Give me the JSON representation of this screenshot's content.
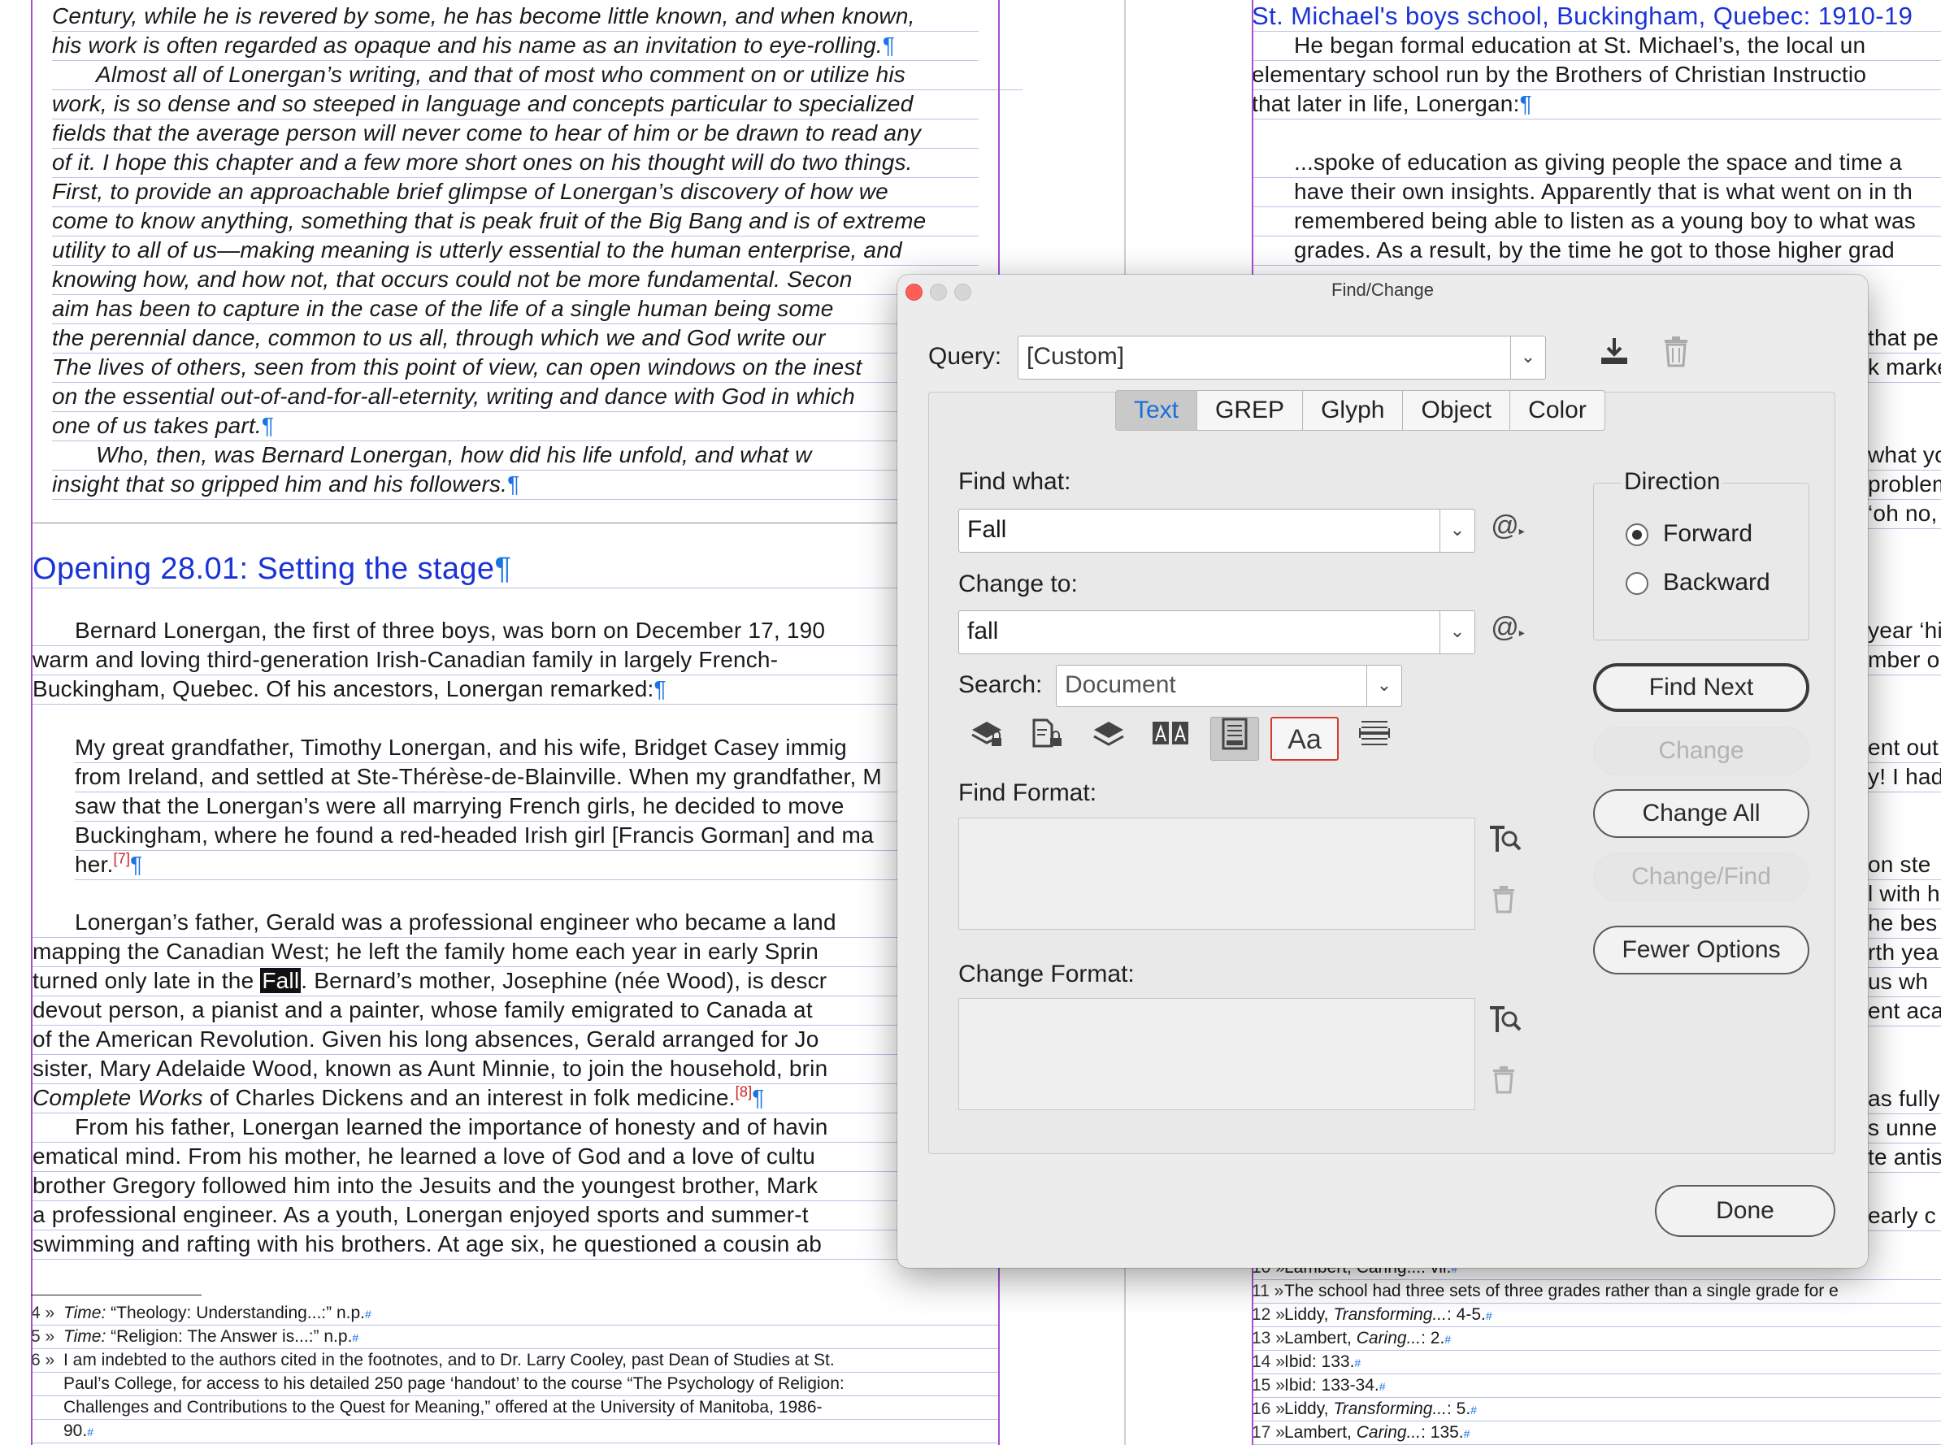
{
  "document": {
    "left_lines": [
      {
        "text": "Century, while he is revered by some, he has become little known, and when known,",
        "italic": true
      },
      {
        "text": "his work is often regarded as opaque and his name as an invitation to eye-rolling.",
        "italic": true,
        "pilcrow": "¶"
      },
      {
        "text": "Almost all of Lonergan’s writing, and that of most who comment on or utilize his",
        "italic": true
      },
      {
        "text": "work, is so dense and so steeped in language and concepts particular to specialized",
        "italic": true
      },
      {
        "text": "fields that the average person will never come to hear of him or be drawn to read any",
        "italic": true
      },
      {
        "text": "of it. I hope this chapter and a few more short ones on his thought will do two things.",
        "italic": true
      },
      {
        "text": "First, to provide an approachable brief glimpse of Lonergan’s discovery of how we",
        "italic": true
      },
      {
        "text": "come to know anything, something that is peak fruit of the Big Bang and is of extreme",
        "italic": true
      },
      {
        "text": "utility to all of us—making meaning is utterly essential to the human enterprise, and",
        "italic": true
      },
      {
        "text": "knowing how, and how not, that occurs could not be more fundamental. Secon",
        "italic": true
      },
      {
        "text": "aim has been to capture in the case of the life of a single human being some",
        "italic": true
      },
      {
        "text": "the perennial dance, common to us all, through which we and God write our",
        "italic": true
      },
      {
        "text": "The lives of others, seen from this point of view, can open windows on the inest",
        "italic": true
      },
      {
        "text": "on the essential out-of-and-for-all-eternity, writing and dance with God in which",
        "italic": true
      },
      {
        "text": "one of us takes part.",
        "italic": true,
        "pilcrow": "¶"
      },
      {
        "text": "Who, then, was Bernard Lonergan, how did his life unfold, and what w",
        "italic": true
      },
      {
        "text": "insight that so gripped him and his followers.",
        "italic": true,
        "pilcrow": "¶"
      }
    ],
    "left_heading": {
      "text": "Opening 28.01: Setting the stage",
      "pilcrow": "¶"
    },
    "left_body_1": [
      {
        "text": "Bernard Lonergan, the first of three boys, was born on December 17, 190"
      },
      {
        "text": "warm and loving third-generation Irish-Canadian family in largely French-"
      },
      {
        "text": "Buckingham, Quebec. Of his ancestors, Lonergan remarked:",
        "pilcrow": "¶"
      }
    ],
    "left_quote": [
      {
        "text": "My great grandfather, Timothy Lonergan, and his wife, Bridget Casey immig"
      },
      {
        "text": "from Ireland, and settled at Ste-Thérèse-de-Blainville. When my grandfather, M"
      },
      {
        "text": "saw that the Lonergan’s were all marrying French girls, he decided to move"
      },
      {
        "text": "Buckingham, where he found a red-headed Irish girl [Francis Gorman] and ma"
      },
      {
        "text": "her.",
        "fnref": "[7]",
        "pilcrow": "¶"
      }
    ],
    "left_body_2": [
      {
        "text": "Lonergan’s father, Gerald was a professional engineer who became a land"
      },
      {
        "text": "mapping the Canadian West; he left the family home each year in early Sprin"
      },
      {
        "before": "turned only late in the ",
        "highlight": "Fall",
        "after": ". Bernard’s mother, Josephine (née Wood), is descr"
      },
      {
        "text": "devout person, a pianist and a painter, whose family emigrated to Canada at"
      },
      {
        "text": "of the American Revolution. Given his long absences, Gerald arranged for Jo"
      },
      {
        "text": "sister, Mary Adelaide Wood, known as Aunt Minnie, to join the household, brin"
      },
      {
        "italic_part": "Complete Works",
        "text": " of Charles Dickens and an interest in folk medicine.",
        "fnref": "[8]",
        "pilcrow": "¶"
      },
      {
        "text": "From his father, Lonergan learned the importance of honesty and of havin"
      },
      {
        "text": "ematical mind. From his mother, he learned a love of God and a love of cultu"
      },
      {
        "text": "brother Gregory followed him into the Jesuits and the youngest brother, Mark"
      },
      {
        "text": "a professional engineer. As a youth, Lonergan enjoyed sports and summer-t"
      },
      {
        "text": "swimming and rafting with his brothers. At age six, he questioned a cousin ab"
      }
    ],
    "left_footnotes": [
      {
        "num": "4",
        "arrow": "»",
        "italic_part": "Time:",
        "text": " “Theology: Understanding...:” n.p.",
        "mark": "#"
      },
      {
        "num": "5",
        "arrow": "»",
        "italic_part": "Time:",
        "text": " “Religion: The Answer is...:” n.p.",
        "mark": "#"
      },
      {
        "num": "6",
        "arrow": "»",
        "text": "I am indebted to the authors cited in the footnotes, and to Dr. Larry Cooley, past Dean of Studies at St."
      },
      {
        "num": "",
        "arrow": "",
        "text": "Paul’s College, for access to his detailed 250 page ‘handout’ to the course “The Psychology of Religion:"
      },
      {
        "num": "",
        "arrow": "",
        "text": "Challenges and Contributions to the Quest for Meaning,” offered at the University of Manitoba, 1986-"
      },
      {
        "num": "",
        "arrow": "",
        "text": "90.",
        "mark": "#"
      }
    ],
    "right_heading": {
      "text": "St. Michael's boys school, Buckingham, Quebec: 1910-19"
    },
    "right_lines": [
      {
        "text": "He began formal education at St. Michael’s, the local un"
      },
      {
        "text": "elementary school run by the Brothers of Christian Instructio"
      },
      {
        "text": "that later in life, Lonergan:",
        "pilcrow": "¶"
      },
      {
        "text": "...spoke of education as giving people the space and time a"
      },
      {
        "text": "have their own insights. Apparently that is what went on in th"
      },
      {
        "text": "remembered being able to listen as a young boy to what was"
      },
      {
        "text": "grades. As a result, by the time he got to those higher grad"
      }
    ],
    "right_fragments": [
      "that pe",
      "k marke",
      "what yo",
      "problem",
      "‘oh no,",
      "year ‘hig",
      "mber o",
      "ent out",
      "y! I had",
      "on ste",
      "l with h",
      "he bes",
      "rth yea",
      "us wh",
      "ent aca",
      "as fully",
      "s unne",
      "te antis",
      "early c"
    ],
    "right_footnotes": [
      {
        "num": "10",
        "arrow": "»",
        "text": "Lambert, Caring...: vii.",
        "mark": "#"
      },
      {
        "num": "11",
        "arrow": "»",
        "text": "The school had three sets of three grades rather than a single grade for e"
      },
      {
        "num": "12",
        "arrow": "»",
        "text": "Liddy, ",
        "italic_part": "Transforming...",
        "after": ": 4-5.",
        "mark": "#"
      },
      {
        "num": "13",
        "arrow": "»",
        "text": "Lambert, ",
        "italic_part": "Caring...",
        "after": ": 2.",
        "mark": "#"
      },
      {
        "num": "14",
        "arrow": "»",
        "text": "Ibid: 133.",
        "mark": "#"
      },
      {
        "num": "15",
        "arrow": "»",
        "text": "Ibid: 133-34.",
        "mark": "#"
      },
      {
        "num": "16",
        "arrow": "»",
        "text": "Liddy, ",
        "italic_part": "Transforming...",
        "after": ": 5.",
        "mark": "#"
      },
      {
        "num": "17",
        "arrow": "»",
        "text": "Lambert, ",
        "italic_part": "Caring...",
        "after": ": 135.",
        "mark": "#"
      }
    ]
  },
  "dialog": {
    "title": "Find/Change",
    "query_label": "Query:",
    "query_value": "[Custom]",
    "tabs": [
      {
        "label": "Text",
        "active": true
      },
      {
        "label": "GREP",
        "active": false
      },
      {
        "label": "Glyph",
        "active": false
      },
      {
        "label": "Object",
        "active": false
      },
      {
        "label": "Color",
        "active": false
      }
    ],
    "find_label": "Find what:",
    "find_value": "Fall",
    "change_label": "Change to:",
    "change_value": "fall",
    "search_label": "Search:",
    "search_value": "Document",
    "special_char_icon": "@",
    "find_format_label": "Find Format:",
    "change_format_label": "Change Format:",
    "direction_label": "Direction",
    "direction_options": [
      {
        "label": "Forward",
        "selected": true
      },
      {
        "label": "Backward",
        "selected": false
      }
    ],
    "buttons": {
      "find_next": "Find Next",
      "change": "Change",
      "change_all": "Change All",
      "change_find": "Change/Find",
      "fewer_options": "Fewer Options",
      "done": "Done"
    },
    "case_sensitive_label": "Aa",
    "colors": {
      "accent": "#1a6fd8",
      "case_outline": "#d9382b",
      "close": "#fd5f57",
      "inactive_light": "#d6d6d6"
    }
  }
}
